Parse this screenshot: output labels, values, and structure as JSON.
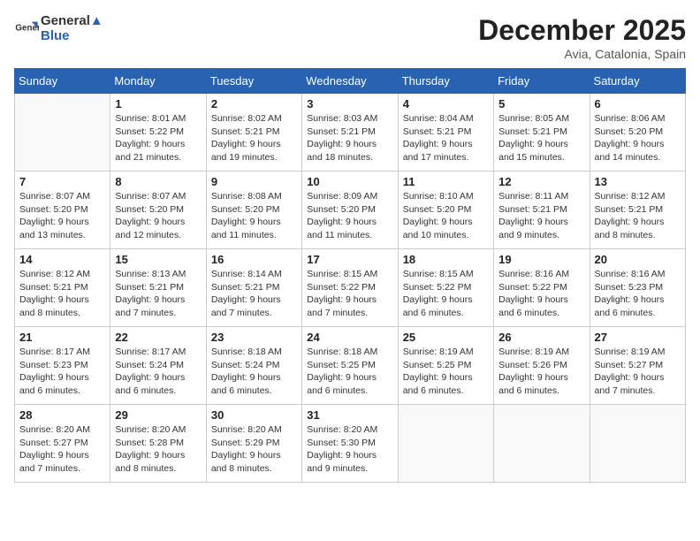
{
  "header": {
    "logo_line1": "General",
    "logo_line2": "Blue",
    "month": "December 2025",
    "location": "Avia, Catalonia, Spain"
  },
  "days_of_week": [
    "Sunday",
    "Monday",
    "Tuesday",
    "Wednesday",
    "Thursday",
    "Friday",
    "Saturday"
  ],
  "weeks": [
    [
      {
        "day": "",
        "info": ""
      },
      {
        "day": "1",
        "info": "Sunrise: 8:01 AM\nSunset: 5:22 PM\nDaylight: 9 hours\nand 21 minutes."
      },
      {
        "day": "2",
        "info": "Sunrise: 8:02 AM\nSunset: 5:21 PM\nDaylight: 9 hours\nand 19 minutes."
      },
      {
        "day": "3",
        "info": "Sunrise: 8:03 AM\nSunset: 5:21 PM\nDaylight: 9 hours\nand 18 minutes."
      },
      {
        "day": "4",
        "info": "Sunrise: 8:04 AM\nSunset: 5:21 PM\nDaylight: 9 hours\nand 17 minutes."
      },
      {
        "day": "5",
        "info": "Sunrise: 8:05 AM\nSunset: 5:21 PM\nDaylight: 9 hours\nand 15 minutes."
      },
      {
        "day": "6",
        "info": "Sunrise: 8:06 AM\nSunset: 5:20 PM\nDaylight: 9 hours\nand 14 minutes."
      }
    ],
    [
      {
        "day": "7",
        "info": "Sunrise: 8:07 AM\nSunset: 5:20 PM\nDaylight: 9 hours\nand 13 minutes."
      },
      {
        "day": "8",
        "info": "Sunrise: 8:07 AM\nSunset: 5:20 PM\nDaylight: 9 hours\nand 12 minutes."
      },
      {
        "day": "9",
        "info": "Sunrise: 8:08 AM\nSunset: 5:20 PM\nDaylight: 9 hours\nand 11 minutes."
      },
      {
        "day": "10",
        "info": "Sunrise: 8:09 AM\nSunset: 5:20 PM\nDaylight: 9 hours\nand 11 minutes."
      },
      {
        "day": "11",
        "info": "Sunrise: 8:10 AM\nSunset: 5:20 PM\nDaylight: 9 hours\nand 10 minutes."
      },
      {
        "day": "12",
        "info": "Sunrise: 8:11 AM\nSunset: 5:21 PM\nDaylight: 9 hours\nand 9 minutes."
      },
      {
        "day": "13",
        "info": "Sunrise: 8:12 AM\nSunset: 5:21 PM\nDaylight: 9 hours\nand 8 minutes."
      }
    ],
    [
      {
        "day": "14",
        "info": "Sunrise: 8:12 AM\nSunset: 5:21 PM\nDaylight: 9 hours\nand 8 minutes."
      },
      {
        "day": "15",
        "info": "Sunrise: 8:13 AM\nSunset: 5:21 PM\nDaylight: 9 hours\nand 7 minutes."
      },
      {
        "day": "16",
        "info": "Sunrise: 8:14 AM\nSunset: 5:21 PM\nDaylight: 9 hours\nand 7 minutes."
      },
      {
        "day": "17",
        "info": "Sunrise: 8:15 AM\nSunset: 5:22 PM\nDaylight: 9 hours\nand 7 minutes."
      },
      {
        "day": "18",
        "info": "Sunrise: 8:15 AM\nSunset: 5:22 PM\nDaylight: 9 hours\nand 6 minutes."
      },
      {
        "day": "19",
        "info": "Sunrise: 8:16 AM\nSunset: 5:22 PM\nDaylight: 9 hours\nand 6 minutes."
      },
      {
        "day": "20",
        "info": "Sunrise: 8:16 AM\nSunset: 5:23 PM\nDaylight: 9 hours\nand 6 minutes."
      }
    ],
    [
      {
        "day": "21",
        "info": "Sunrise: 8:17 AM\nSunset: 5:23 PM\nDaylight: 9 hours\nand 6 minutes."
      },
      {
        "day": "22",
        "info": "Sunrise: 8:17 AM\nSunset: 5:24 PM\nDaylight: 9 hours\nand 6 minutes."
      },
      {
        "day": "23",
        "info": "Sunrise: 8:18 AM\nSunset: 5:24 PM\nDaylight: 9 hours\nand 6 minutes."
      },
      {
        "day": "24",
        "info": "Sunrise: 8:18 AM\nSunset: 5:25 PM\nDaylight: 9 hours\nand 6 minutes."
      },
      {
        "day": "25",
        "info": "Sunrise: 8:19 AM\nSunset: 5:25 PM\nDaylight: 9 hours\nand 6 minutes."
      },
      {
        "day": "26",
        "info": "Sunrise: 8:19 AM\nSunset: 5:26 PM\nDaylight: 9 hours\nand 6 minutes."
      },
      {
        "day": "27",
        "info": "Sunrise: 8:19 AM\nSunset: 5:27 PM\nDaylight: 9 hours\nand 7 minutes."
      }
    ],
    [
      {
        "day": "28",
        "info": "Sunrise: 8:20 AM\nSunset: 5:27 PM\nDaylight: 9 hours\nand 7 minutes."
      },
      {
        "day": "29",
        "info": "Sunrise: 8:20 AM\nSunset: 5:28 PM\nDaylight: 9 hours\nand 8 minutes."
      },
      {
        "day": "30",
        "info": "Sunrise: 8:20 AM\nSunset: 5:29 PM\nDaylight: 9 hours\nand 8 minutes."
      },
      {
        "day": "31",
        "info": "Sunrise: 8:20 AM\nSunset: 5:30 PM\nDaylight: 9 hours\nand 9 minutes."
      },
      {
        "day": "",
        "info": ""
      },
      {
        "day": "",
        "info": ""
      },
      {
        "day": "",
        "info": ""
      }
    ]
  ]
}
